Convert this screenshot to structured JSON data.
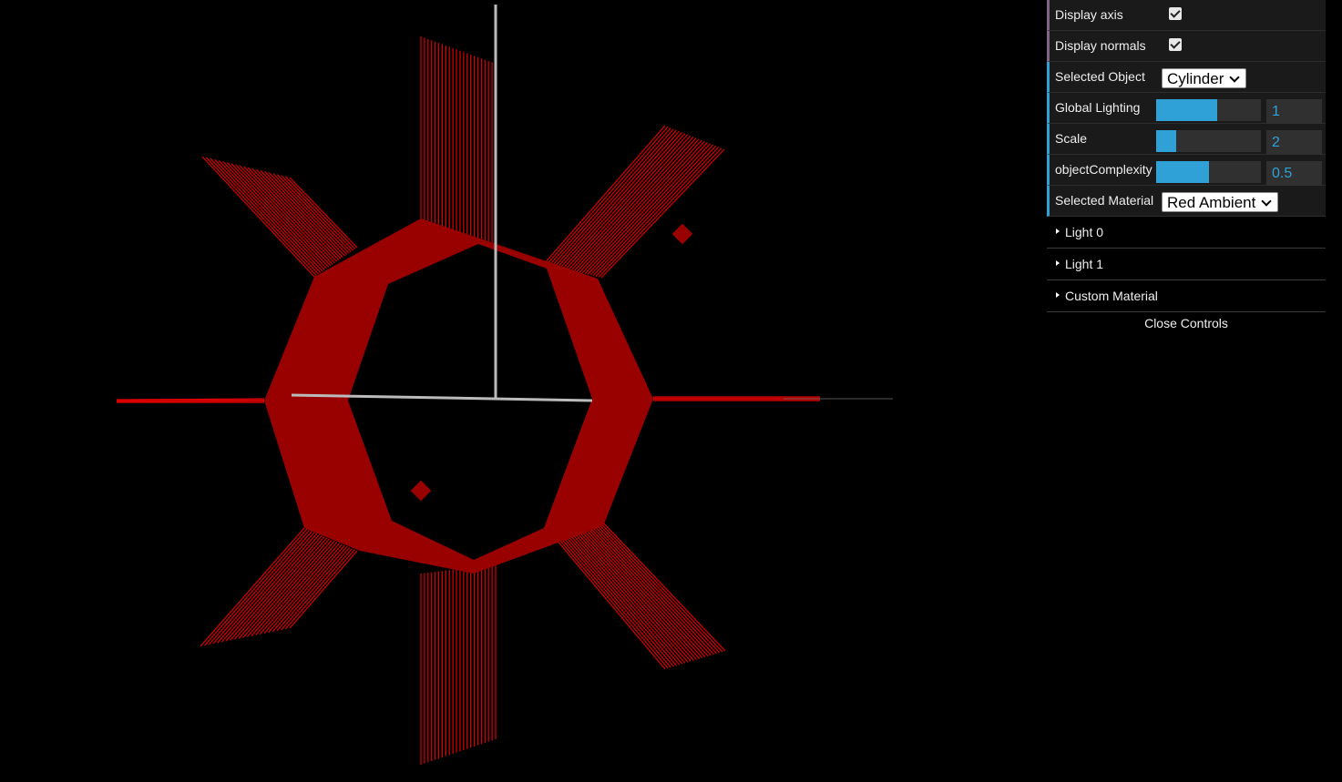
{
  "scene": {
    "colors": {
      "ring": "#990000",
      "normals": "#dd0000",
      "axis": "#ffffff"
    }
  },
  "gui": {
    "display_axis": {
      "label": "Display axis",
      "checked": true
    },
    "display_normals": {
      "label": "Display normals",
      "checked": true
    },
    "selected_object": {
      "label": "Selected Object",
      "value": "Cylinder"
    },
    "global_lighting": {
      "label": "Global Lighting",
      "value": "1",
      "fraction": 0.58
    },
    "scale": {
      "label": "Scale",
      "value": "2",
      "fraction": 0.19
    },
    "object_complexity": {
      "label": "objectComplexity",
      "value": "0.5",
      "fraction": 0.5
    },
    "selected_material": {
      "label": "Selected Material",
      "value": "Red Ambient"
    },
    "folders": [
      {
        "label": "Light 0"
      },
      {
        "label": "Light 1"
      },
      {
        "label": "Custom Material"
      }
    ],
    "close_label": "Close Controls"
  }
}
